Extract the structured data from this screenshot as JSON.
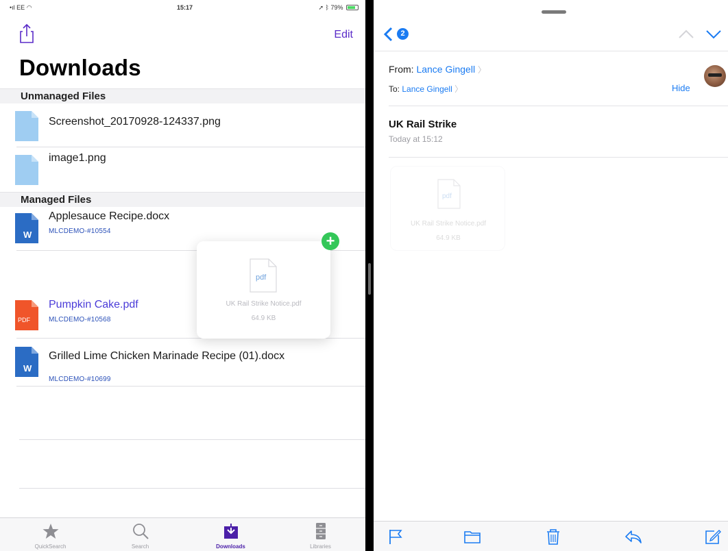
{
  "status_bar": {
    "carrier": "EE",
    "time": "15:17",
    "battery": "79%"
  },
  "downloads": {
    "edit_label": "Edit",
    "title": "Downloads",
    "sections": {
      "unmanaged": "Unmanaged Files",
      "managed": "Managed Files"
    },
    "unmanaged_files": [
      {
        "name": "Screenshot_20170928-124337.png"
      },
      {
        "name": "image1.png"
      }
    ],
    "managed_files": [
      {
        "name": "Applesauce Recipe.docx",
        "id": "MLCDEMO-#10554",
        "type": "docx"
      },
      {
        "name": "Pumpkin Cake.pdf",
        "id": "MLCDEMO-#10568",
        "type": "pdf"
      },
      {
        "name": "Grilled Lime Chicken Marinade Recipe (01).docx",
        "id": "MLCDEMO-#10699",
        "type": "docx"
      }
    ],
    "drag_item": {
      "icon_label": "pdf",
      "name": "UK Rail Strike Notice.pdf",
      "size": "64.9 KB",
      "badge": "+"
    },
    "tabs": [
      {
        "label": "QuickSearch",
        "icon": "star-icon",
        "active": false
      },
      {
        "label": "Search",
        "icon": "search-icon",
        "active": false
      },
      {
        "label": "Downloads",
        "icon": "download-icon",
        "active": true
      },
      {
        "label": "Libraries",
        "icon": "cabinet-icon",
        "active": false
      }
    ],
    "pdf_badge": "PDF",
    "word_badge": "W"
  },
  "mail": {
    "back_count": "2",
    "from_label": "From:",
    "from_name": "Lance Gingell",
    "to_label": "To:",
    "to_name": "Lance Gingell",
    "hide_label": "Hide",
    "subject": "UK Rail Strike",
    "date": "Today at 15:12",
    "attachment": {
      "icon_label": "pdf",
      "name": "UK Rail Strike Notice.pdf",
      "size": "64.9 KB"
    },
    "toolbar": [
      "flag-icon",
      "folder-icon",
      "trash-icon",
      "reply-icon",
      "compose-icon"
    ]
  },
  "colors": {
    "accent_purple": "#5a2bc8",
    "ios_blue": "#1a7bf2",
    "docx_blue": "#2b6cc4",
    "pdf_orange": "#f0552a",
    "file_light_blue": "#9fcdf2",
    "add_green": "#34c759"
  }
}
